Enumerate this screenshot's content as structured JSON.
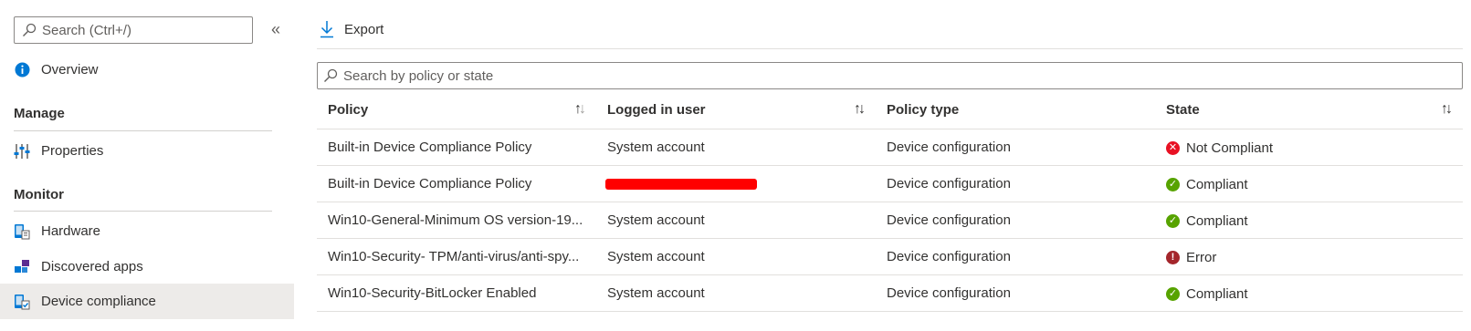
{
  "sidebar": {
    "search_placeholder": "Search (Ctrl+/)",
    "collapse_glyph": "«",
    "overview_label": "Overview",
    "sections": {
      "manage": "Manage",
      "monitor": "Monitor"
    },
    "items": [
      {
        "label": "Properties",
        "icon": "properties-icon"
      },
      {
        "label": "Hardware",
        "icon": "hardware-icon"
      },
      {
        "label": "Discovered apps",
        "icon": "discovered-apps-icon"
      },
      {
        "label": "Device compliance",
        "icon": "device-compliance-icon",
        "active": true
      }
    ]
  },
  "toolbar": {
    "export_label": "Export"
  },
  "filter": {
    "placeholder": "Search by policy or state"
  },
  "table": {
    "columns": [
      "Policy",
      "Logged in user",
      "Policy type",
      "State"
    ],
    "rows": [
      {
        "policy": "Built-in Device Compliance Policy",
        "user": "System account",
        "type": "Device configuration",
        "state": "Not Compliant",
        "status": "not-compliant"
      },
      {
        "policy": "Built-in Device Compliance Policy",
        "user": "",
        "redacted": true,
        "type": "Device configuration",
        "state": "Compliant",
        "status": "compliant"
      },
      {
        "policy": "Win10-General-Minimum OS version-19...",
        "user": "System account",
        "type": "Device configuration",
        "state": "Compliant",
        "status": "compliant"
      },
      {
        "policy": "Win10-Security- TPM/anti-virus/anti-spy...",
        "user": "System account",
        "type": "Device configuration",
        "state": "Error",
        "status": "error"
      },
      {
        "policy": "Win10-Security-BitLocker Enabled",
        "user": "System account",
        "type": "Device configuration",
        "state": "Compliant",
        "status": "compliant"
      }
    ]
  },
  "colors": {
    "compliant": "#57a300",
    "not_compliant": "#e81123",
    "error": "#a4262c",
    "info": "#0078d4",
    "redaction": "#ff0000"
  }
}
